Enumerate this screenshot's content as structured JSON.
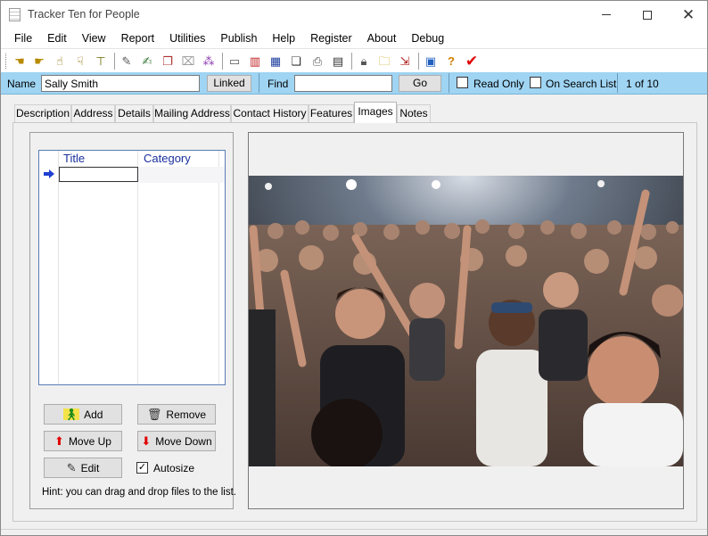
{
  "window": {
    "title": "Tracker Ten for People"
  },
  "menu": [
    "File",
    "Edit",
    "View",
    "Report",
    "Utilities",
    "Publish",
    "Help",
    "Register",
    "About",
    "Debug"
  ],
  "toolbar": {
    "icons": [
      "pointing-hand-left-icon",
      "pointing-hand-right-icon",
      "hand-up-icon",
      "hand-down-icon",
      "stamp-icon",
      "edit-page-icon",
      "form-icon",
      "copy-record-icon",
      "delete-record-icon",
      "sort-icon",
      "open-folder-icon",
      "report-chart-icon",
      "table-view-icon",
      "pages-icon",
      "print-icon",
      "lock-icon",
      "folder-icon",
      "export-icon",
      "calculator-icon",
      "help-icon",
      "check-icon"
    ]
  },
  "searchbar": {
    "name_label": "Name",
    "name_value": "Sally Smith",
    "linked_label": "Linked",
    "find_label": "Find",
    "find_value": "",
    "go_label": "Go",
    "read_only_label": "Read Only",
    "on_search_list_label": "On Search List",
    "record_position": "1 of 10"
  },
  "tabs": [
    "Description",
    "Address",
    "Details",
    "Mailing Address",
    "Contact History",
    "Features",
    "Images",
    "Notes"
  ],
  "active_tab": "Images",
  "images_tab": {
    "columns": [
      "Title",
      "Category"
    ],
    "buttons": {
      "add": "Add",
      "remove": "Remove",
      "move_up": "Move Up",
      "move_down": "Move Down",
      "edit": "Edit"
    },
    "autosize_label": "Autosize",
    "autosize_checked": true,
    "hint": "Hint: you can drag and drop files to the list."
  },
  "colors": {
    "searchbar": "#9fd4f3",
    "header_text": "#1a2f9e",
    "check_red": "#e00000"
  }
}
